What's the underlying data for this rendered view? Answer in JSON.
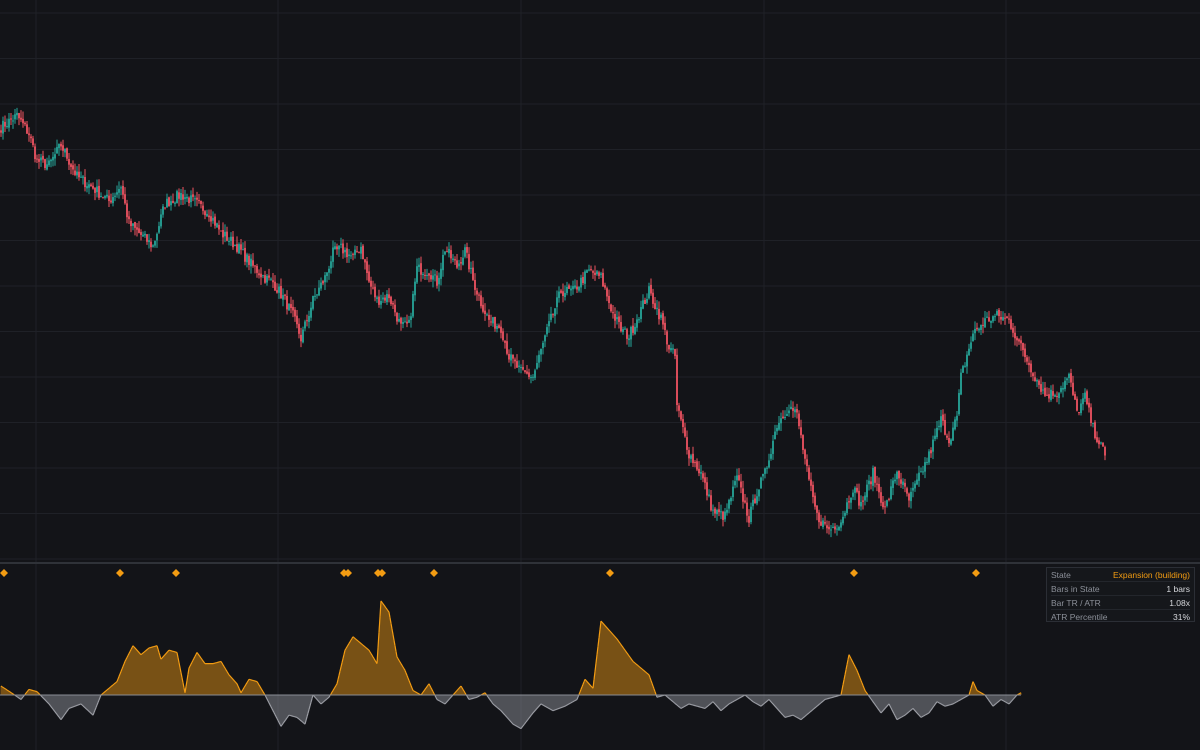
{
  "colors": {
    "background": "#131418",
    "grid": "#1f2127",
    "up": "#26a69a",
    "down": "#ef5361",
    "expansion": "#f39c12",
    "contraction": "#9a9ca3",
    "separator": "#2f3238"
  },
  "chart_data": [
    {
      "type": "candlestick",
      "title": "",
      "grid": true,
      "series": [
        {
          "anchors": [
            {
              "i": 0,
              "c": 188
            },
            {
              "i": 8,
              "c": 193
            },
            {
              "i": 14,
              "c": 185
            },
            {
              "i": 18,
              "c": 173
            },
            {
              "i": 24,
              "c": 171
            },
            {
              "i": 30,
              "c": 180
            },
            {
              "i": 38,
              "c": 166
            },
            {
              "i": 46,
              "c": 161
            },
            {
              "i": 54,
              "c": 155
            },
            {
              "i": 60,
              "c": 162
            },
            {
              "i": 64,
              "c": 145
            },
            {
              "i": 70,
              "c": 140
            },
            {
              "i": 76,
              "c": 135
            },
            {
              "i": 82,
              "c": 154
            },
            {
              "i": 90,
              "c": 158
            },
            {
              "i": 96,
              "c": 155
            },
            {
              "i": 104,
              "c": 150
            },
            {
              "i": 110,
              "c": 141
            },
            {
              "i": 114,
              "c": 138
            },
            {
              "i": 118,
              "c": 135
            },
            {
              "i": 126,
              "c": 126
            },
            {
              "i": 132,
              "c": 121
            },
            {
              "i": 136,
              "c": 119
            },
            {
              "i": 142,
              "c": 111
            },
            {
              "i": 146,
              "c": 104
            },
            {
              "i": 150,
              "c": 94
            },
            {
              "i": 156,
              "c": 111
            },
            {
              "i": 162,
              "c": 121
            },
            {
              "i": 166,
              "c": 132
            },
            {
              "i": 170,
              "c": 134
            },
            {
              "i": 176,
              "c": 130
            },
            {
              "i": 180,
              "c": 135
            },
            {
              "i": 184,
              "c": 119
            },
            {
              "i": 188,
              "c": 111
            },
            {
              "i": 194,
              "c": 113
            },
            {
              "i": 200,
              "c": 99
            },
            {
              "i": 204,
              "c": 100
            },
            {
              "i": 208,
              "c": 125
            },
            {
              "i": 214,
              "c": 124
            },
            {
              "i": 218,
              "c": 119
            },
            {
              "i": 222,
              "c": 134
            },
            {
              "i": 228,
              "c": 126
            },
            {
              "i": 232,
              "c": 133
            },
            {
              "i": 236,
              "c": 120
            },
            {
              "i": 240,
              "c": 110
            },
            {
              "i": 244,
              "c": 102
            },
            {
              "i": 250,
              "c": 99
            },
            {
              "i": 254,
              "c": 86
            },
            {
              "i": 260,
              "c": 79
            },
            {
              "i": 266,
              "c": 77
            },
            {
              "i": 274,
              "c": 100
            },
            {
              "i": 280,
              "c": 115
            },
            {
              "i": 286,
              "c": 115
            },
            {
              "i": 294,
              "c": 124
            },
            {
              "i": 300,
              "c": 121
            },
            {
              "i": 306,
              "c": 105
            },
            {
              "i": 310,
              "c": 98
            },
            {
              "i": 314,
              "c": 95
            },
            {
              "i": 318,
              "c": 103
            },
            {
              "i": 324,
              "c": 115
            },
            {
              "i": 330,
              "c": 103
            },
            {
              "i": 334,
              "c": 90
            },
            {
              "i": 337,
              "c": 86
            },
            {
              "i": 338,
              "c": 64
            },
            {
              "i": 344,
              "c": 43
            },
            {
              "i": 350,
              "c": 34
            },
            {
              "i": 356,
              "c": 17
            },
            {
              "i": 362,
              "c": 15
            },
            {
              "i": 368,
              "c": 32
            },
            {
              "i": 374,
              "c": 14
            },
            {
              "i": 378,
              "c": 26
            },
            {
              "i": 382,
              "c": 34
            },
            {
              "i": 388,
              "c": 56
            },
            {
              "i": 394,
              "c": 64
            },
            {
              "i": 398,
              "c": 60
            },
            {
              "i": 404,
              "c": 30
            },
            {
              "i": 408,
              "c": 15
            },
            {
              "i": 414,
              "c": 9
            },
            {
              "i": 420,
              "c": 13
            },
            {
              "i": 426,
              "c": 28
            },
            {
              "i": 430,
              "c": 20
            },
            {
              "i": 436,
              "c": 34
            },
            {
              "i": 442,
              "c": 18
            },
            {
              "i": 448,
              "c": 35
            },
            {
              "i": 454,
              "c": 22
            },
            {
              "i": 458,
              "c": 30
            },
            {
              "i": 464,
              "c": 42
            },
            {
              "i": 470,
              "c": 58
            },
            {
              "i": 474,
              "c": 49
            },
            {
              "i": 478,
              "c": 59
            },
            {
              "i": 480,
              "c": 77
            },
            {
              "i": 486,
              "c": 96
            },
            {
              "i": 492,
              "c": 102
            },
            {
              "i": 498,
              "c": 104
            },
            {
              "i": 504,
              "c": 102
            },
            {
              "i": 510,
              "c": 90
            },
            {
              "i": 516,
              "c": 79
            },
            {
              "i": 522,
              "c": 69
            },
            {
              "i": 528,
              "c": 70
            },
            {
              "i": 534,
              "c": 77
            },
            {
              "i": 538,
              "c": 61
            },
            {
              "i": 542,
              "c": 68
            },
            {
              "i": 546,
              "c": 54
            },
            {
              "i": 552,
              "c": 42
            }
          ]
        }
      ]
    },
    {
      "type": "area",
      "title": "",
      "baseline": 0,
      "series": [
        {
          "points": [
            [
              0,
              8
            ],
            [
              6,
              1
            ],
            [
              10,
              -4
            ],
            [
              14,
              5
            ],
            [
              18,
              3
            ],
            [
              24,
              -8
            ],
            [
              30,
              -22
            ],
            [
              34,
              -12
            ],
            [
              40,
              -8
            ],
            [
              46,
              -18
            ],
            [
              50,
              0
            ],
            [
              54,
              6
            ],
            [
              58,
              12
            ],
            [
              62,
              30
            ],
            [
              66,
              44
            ],
            [
              70,
              36
            ],
            [
              74,
              42
            ],
            [
              78,
              44
            ],
            [
              80,
              32
            ],
            [
              84,
              40
            ],
            [
              88,
              38
            ],
            [
              92,
              2
            ],
            [
              94,
              24
            ],
            [
              98,
              38
            ],
            [
              102,
              28
            ],
            [
              106,
              28
            ],
            [
              110,
              30
            ],
            [
              114,
              18
            ],
            [
              118,
              10
            ],
            [
              120,
              2
            ],
            [
              124,
              14
            ],
            [
              128,
              12
            ],
            [
              132,
              0
            ],
            [
              136,
              -14
            ],
            [
              140,
              -28
            ],
            [
              144,
              -18
            ],
            [
              148,
              -20
            ],
            [
              152,
              -26
            ],
            [
              156,
              0
            ],
            [
              160,
              -8
            ],
            [
              164,
              -2
            ],
            [
              168,
              10
            ],
            [
              172,
              40
            ],
            [
              176,
              52
            ],
            [
              180,
              46
            ],
            [
              184,
              40
            ],
            [
              188,
              28
            ],
            [
              190,
              84
            ],
            [
              194,
              74
            ],
            [
              198,
              34
            ],
            [
              202,
              22
            ],
            [
              206,
              4
            ],
            [
              210,
              0
            ],
            [
              214,
              10
            ],
            [
              218,
              -4
            ],
            [
              222,
              -8
            ],
            [
              226,
              0
            ],
            [
              230,
              8
            ],
            [
              234,
              -4
            ],
            [
              238,
              -2
            ],
            [
              242,
              2
            ],
            [
              246,
              -8
            ],
            [
              250,
              -14
            ],
            [
              256,
              -26
            ],
            [
              260,
              -30
            ],
            [
              266,
              -16
            ],
            [
              270,
              -8
            ],
            [
              276,
              -14
            ],
            [
              282,
              -10
            ],
            [
              288,
              -4
            ],
            [
              292,
              14
            ],
            [
              296,
              6
            ],
            [
              300,
              66
            ],
            [
              304,
              58
            ],
            [
              308,
              50
            ],
            [
              312,
              40
            ],
            [
              316,
              30
            ],
            [
              320,
              24
            ],
            [
              324,
              18
            ],
            [
              328,
              -2
            ],
            [
              332,
              0
            ],
            [
              336,
              -6
            ],
            [
              340,
              -12
            ],
            [
              344,
              -8
            ],
            [
              348,
              -10
            ],
            [
              352,
              -12
            ],
            [
              356,
              -6
            ],
            [
              360,
              -14
            ],
            [
              364,
              -8
            ],
            [
              368,
              -4
            ],
            [
              372,
              0
            ],
            [
              376,
              -6
            ],
            [
              380,
              -10
            ],
            [
              384,
              -4
            ],
            [
              388,
              -12
            ],
            [
              392,
              -20
            ],
            [
              396,
              -18
            ],
            [
              400,
              -22
            ],
            [
              404,
              -16
            ],
            [
              408,
              -10
            ],
            [
              412,
              -4
            ],
            [
              416,
              -2
            ],
            [
              420,
              0
            ],
            [
              424,
              36
            ],
            [
              428,
              22
            ],
            [
              432,
              4
            ],
            [
              436,
              -6
            ],
            [
              440,
              -16
            ],
            [
              444,
              -8
            ],
            [
              448,
              -22
            ],
            [
              452,
              -18
            ],
            [
              456,
              -12
            ],
            [
              460,
              -20
            ],
            [
              464,
              -16
            ],
            [
              468,
              -6
            ],
            [
              472,
              -10
            ],
            [
              476,
              -8
            ],
            [
              480,
              -4
            ],
            [
              484,
              0
            ],
            [
              486,
              12
            ],
            [
              488,
              4
            ],
            [
              492,
              0
            ],
            [
              496,
              -10
            ],
            [
              500,
              -4
            ],
            [
              504,
              -8
            ],
            [
              508,
              0
            ],
            [
              510,
              2
            ]
          ]
        }
      ]
    }
  ],
  "signals": [
    0,
    58,
    86,
    170,
    172,
    187,
    189,
    215,
    303,
    425,
    486
  ],
  "info_panel": {
    "rows": [
      {
        "label": "State",
        "value": "Expansion (building)"
      },
      {
        "label": "Bars in State",
        "value": "1 bars"
      },
      {
        "label": "Bar TR / ATR",
        "value": "1.08x"
      },
      {
        "label": "ATR Percentile",
        "value": "31%"
      }
    ]
  }
}
